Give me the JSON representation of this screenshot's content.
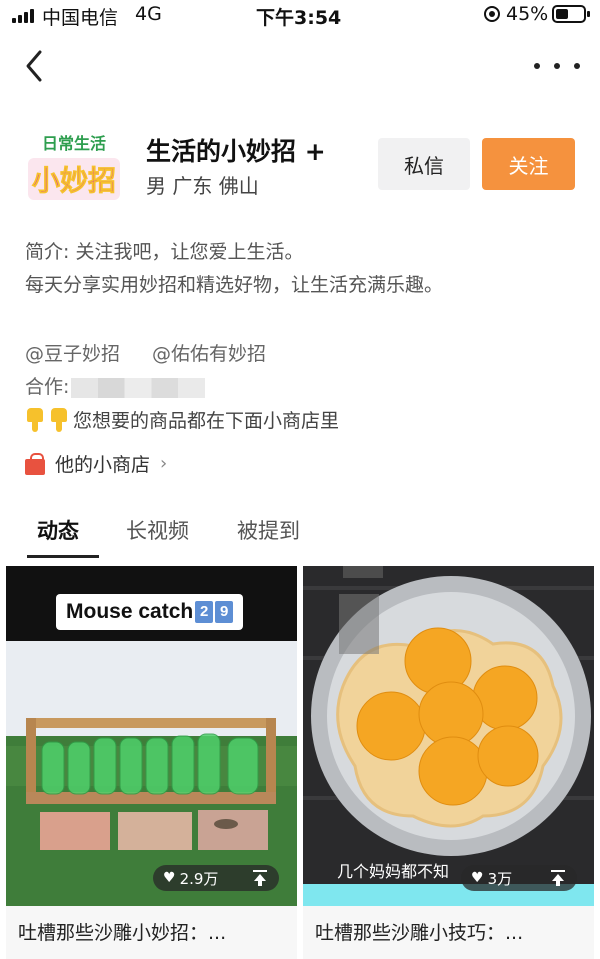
{
  "status_bar": {
    "carrier": "中国电信",
    "network": "4G",
    "time": "下午3:54",
    "battery": "45%"
  },
  "profile": {
    "avatar_text_top": "日常生活",
    "avatar_text_main": "小妙招",
    "name": "生活的小妙招 +",
    "meta": "男 广东 佛山",
    "message_button": "私信",
    "follow_button": "关注",
    "bio_line1": "简介: 关注我吧，让您爱上生活。",
    "bio_line2": "每天分享实用妙招和精选好物，让生活充满乐趣。",
    "mentions": [
      "@豆子妙招",
      "@佑佑有妙招"
    ],
    "cooperation_label": "合作:",
    "hint": "您想要的商品都在下面小商店里",
    "shop_link": "他的小商店",
    "shop_chevron": "›"
  },
  "tabs": [
    {
      "label": "动态",
      "active": true
    },
    {
      "label": "长视频",
      "active": false
    },
    {
      "label": "被提到",
      "active": false
    }
  ],
  "videos": [
    {
      "overlay_title": "Mouse catch",
      "overlay_digits": [
        "2",
        "9"
      ],
      "likes": "2.9万",
      "caption": "吐槽那些沙雕小妙招：..."
    },
    {
      "overlay_sub": "几个妈妈都不知",
      "likes": "3万",
      "caption": "吐槽那些沙雕小技巧：..."
    }
  ],
  "colors": {
    "follow": "#f5923e",
    "message_bg": "#f1f1f2",
    "accent_cyan": "#7fe7ef"
  }
}
